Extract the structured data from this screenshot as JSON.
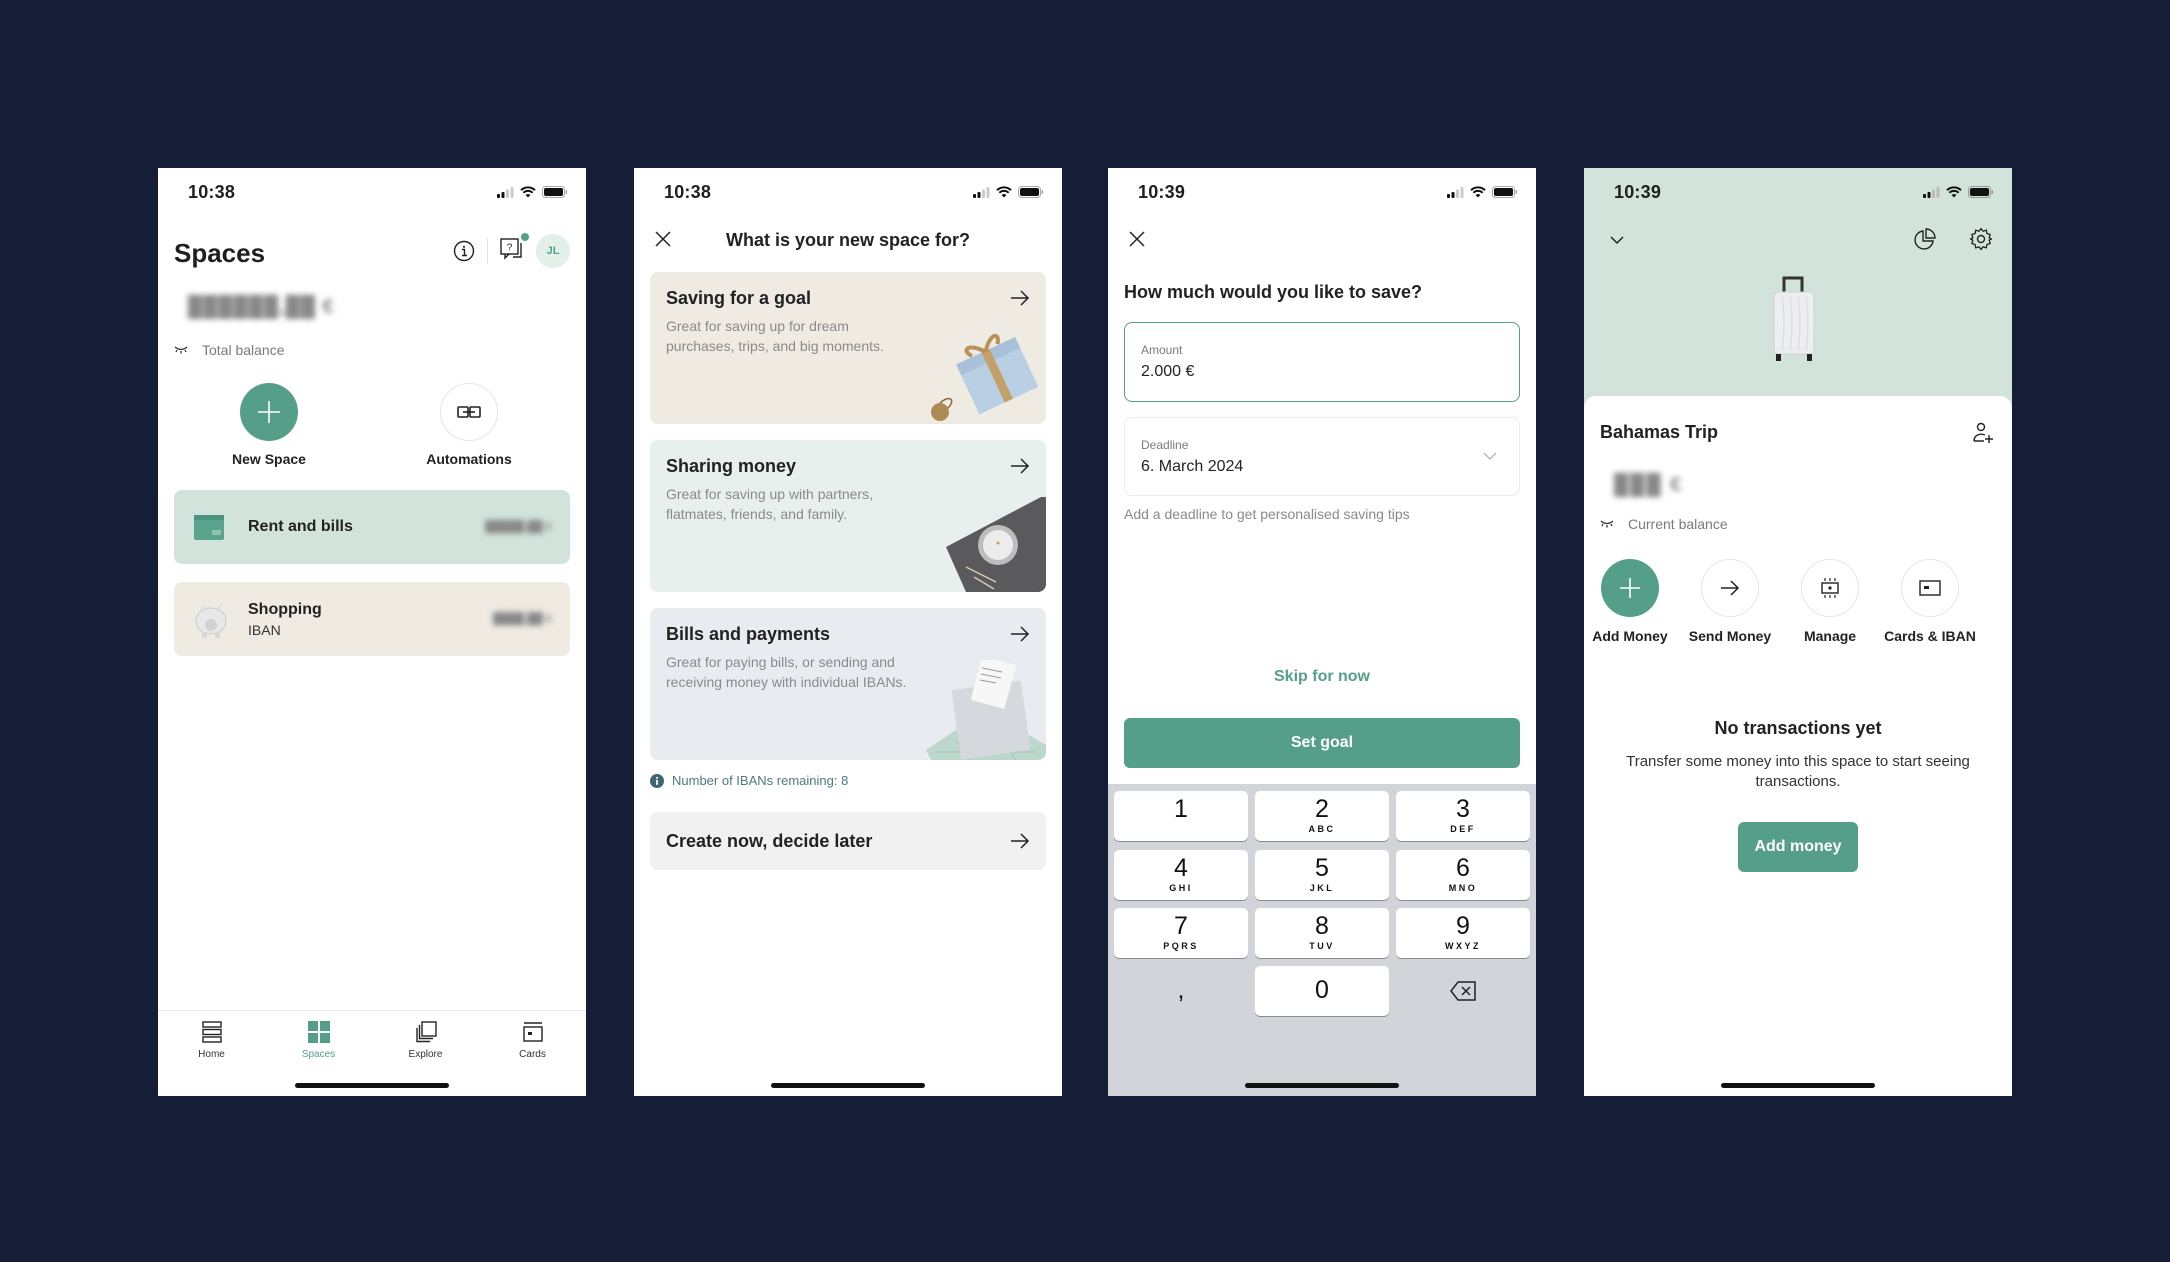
{
  "colors": {
    "background": "#161d36",
    "accent": "#559f89",
    "mint_card": "#d2e3dc",
    "beige_card": "#efebe2"
  },
  "screens": [
    {
      "status": {
        "time": "10:38"
      },
      "header": {
        "title": "Spaces",
        "avatar_initials": "JL"
      },
      "balance": {
        "value_blurred": "██████,██ €",
        "label": "Total balance"
      },
      "quick_actions": [
        {
          "label": "New Space",
          "icon": "plus-icon"
        },
        {
          "label": "Automations",
          "icon": "link-icon"
        }
      ],
      "spaces": [
        {
          "name": "Rent and bills",
          "subtitle": "",
          "amount_blurred": "█████,██ €",
          "icon": "wallet-icon"
        },
        {
          "name": "Shopping",
          "subtitle": "IBAN",
          "amount_blurred": "████,██ €",
          "icon": "piggy-bank-icon"
        }
      ],
      "tabbar": [
        {
          "label": "Home",
          "icon": "home-icon",
          "active": false
        },
        {
          "label": "Spaces",
          "icon": "spaces-icon",
          "active": true
        },
        {
          "label": "Explore",
          "icon": "explore-icon",
          "active": false
        },
        {
          "label": "Cards",
          "icon": "card-icon",
          "active": false
        }
      ]
    },
    {
      "status": {
        "time": "10:38"
      },
      "header": {
        "title": "What is your new space for?"
      },
      "options": [
        {
          "title": "Saving for a goal",
          "description": "Great for saving up for dream purchases, trips, and big moments.",
          "illustration": "gift-box"
        },
        {
          "title": "Sharing money",
          "description": "Great for saving up with partners, flatmates, friends, and family.",
          "illustration": "candle-tray"
        },
        {
          "title": "Bills and payments",
          "description": "Great for paying bills, or sending and receiving money with individual IBANs.",
          "illustration": "envelope-bill"
        }
      ],
      "iban_note": "Number of IBANs remaining: 8",
      "create_later": "Create now, decide later"
    },
    {
      "status": {
        "time": "10:39"
      },
      "question": "How much would you like to save?",
      "amount": {
        "label": "Amount",
        "value": "2.000 €"
      },
      "deadline": {
        "label": "Deadline",
        "value": "6. March 2024"
      },
      "hint": "Add a deadline to get personalised saving tips",
      "skip_label": "Skip for now",
      "set_goal_label": "Set goal",
      "keypad": [
        {
          "num": "1",
          "letters": ""
        },
        {
          "num": "2",
          "letters": "ABC"
        },
        {
          "num": "3",
          "letters": "DEF"
        },
        {
          "num": "4",
          "letters": "GHI"
        },
        {
          "num": "5",
          "letters": "JKL"
        },
        {
          "num": "6",
          "letters": "MNO"
        },
        {
          "num": "7",
          "letters": "PQRS"
        },
        {
          "num": "8",
          "letters": "TUV"
        },
        {
          "num": "9",
          "letters": "WXYZ"
        },
        {
          "num": ",",
          "letters": ""
        },
        {
          "num": "0",
          "letters": ""
        },
        {
          "num": "⌫",
          "letters": ""
        }
      ]
    },
    {
      "status": {
        "time": "10:39"
      },
      "space_name": "Bahamas Trip",
      "balance": {
        "value_blurred": "███ €",
        "label": "Current balance"
      },
      "actions": [
        {
          "label": "Add Money",
          "icon": "plus-icon"
        },
        {
          "label": "Send Money",
          "icon": "arrow-right-icon"
        },
        {
          "label": "Manage",
          "icon": "manage-icon"
        },
        {
          "label": "Cards & IBAN",
          "icon": "card-icon"
        }
      ],
      "empty_state": {
        "title": "No transactions yet",
        "description": "Transfer some money into this space to start seeing transactions.",
        "button_label": "Add money"
      }
    }
  ]
}
